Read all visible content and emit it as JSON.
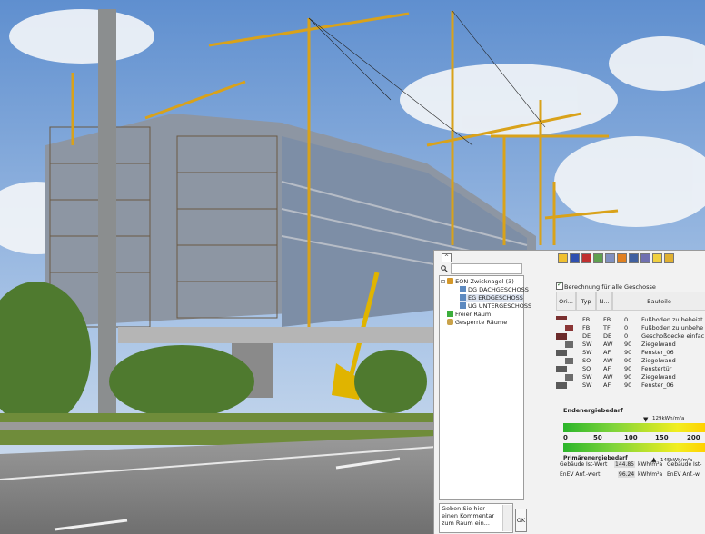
{
  "colors": {
    "sky": "#7fa6d8",
    "building": "#7f8b99",
    "crane": "#d9a21a",
    "grass": "#6f8c3a",
    "road": "#8a8a8a",
    "bar_green": "#2bb52b",
    "bar_yellow": "#f2ee20"
  },
  "tree": {
    "root": "EON-Zwicknagel (3)",
    "floors": [
      "DG DACHGESCHOSS",
      "EG ERDGESCHOSS",
      "UG UNTERGESCHOSS"
    ],
    "free_space": "Freier Raum",
    "locked": "Gesperrte Räume",
    "comment_placeholder": "Geben Sie hier einen Kommentar zum Raum ein...",
    "ok": "OK",
    "collapse_icon": "^"
  },
  "main": {
    "checkbox_label": "Berechnung für alle Geschosse",
    "columns": [
      "Ori...",
      "Typ",
      "N...",
      "Bauteile"
    ],
    "rows": [
      {
        "ori": "FB",
        "typ": "FB",
        "n": "0",
        "bauteil": "Fußboden zu beheizt"
      },
      {
        "ori": "FB",
        "typ": "TF",
        "n": "0",
        "bauteil": "Fußboden zu unbehe"
      },
      {
        "ori": "DE",
        "typ": "DE",
        "n": "0",
        "bauteil": "Geschoßdecke einfac"
      },
      {
        "ori": "SW",
        "typ": "AW",
        "n": "90",
        "bauteil": "Ziegelwand"
      },
      {
        "ori": "SW",
        "typ": "AF",
        "n": "90",
        "bauteil": "Fenster_06"
      },
      {
        "ori": "SO",
        "typ": "AW",
        "n": "90",
        "bauteil": "Ziegelwand"
      },
      {
        "ori": "SO",
        "typ": "AF",
        "n": "90",
        "bauteil": "Fenstertür"
      },
      {
        "ori": "SW",
        "typ": "AW",
        "n": "90",
        "bauteil": "Ziegelwand"
      },
      {
        "ori": "SW",
        "typ": "AF",
        "n": "90",
        "bauteil": "Fenster_06"
      }
    ],
    "energy_title": "Endenergiebedarf",
    "ticks": [
      "0",
      "50",
      "100",
      "150",
      "200"
    ],
    "marker_top": "129kWh/m²a",
    "marker_bottom": "145kWh/m²a",
    "primary_title": "Primärenergiebedarf",
    "gebaeude_label": "Gebäude Ist-Wert",
    "gebaeude_value": "144.85",
    "enev_label": "EnEV Anf.-wert",
    "enev_value": "96.24",
    "unit": "kWh/m²a",
    "gebaeude_label2": "Gebäude Ist-",
    "enev_label2": "EnEV Anf.-w"
  }
}
